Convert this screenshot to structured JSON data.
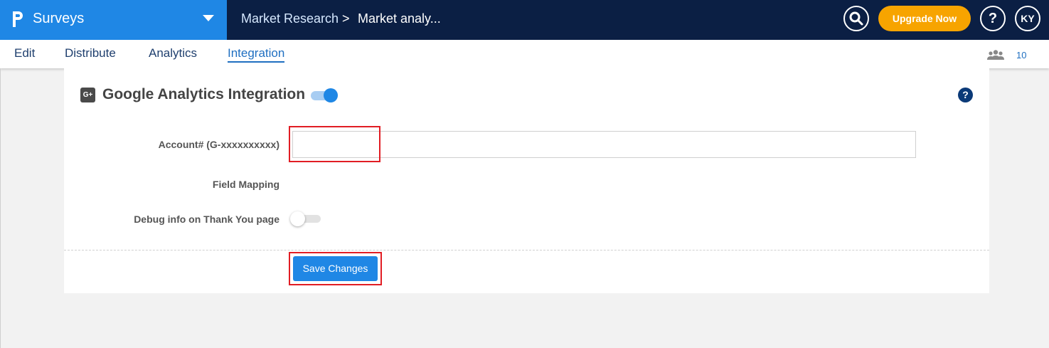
{
  "app": {
    "name": "Surveys"
  },
  "breadcrumb": {
    "item1": "Market Research",
    "separator": ">",
    "item2": "Market analy..."
  },
  "header": {
    "upgrade_label": "Upgrade Now",
    "help_label": "?",
    "avatar_initials": "KY"
  },
  "tabs": [
    {
      "label": "Edit"
    },
    {
      "label": "Distribute"
    },
    {
      "label": "Analytics"
    },
    {
      "label": "Integration",
      "active": true
    }
  ],
  "collaborators": {
    "count": "10"
  },
  "panel": {
    "badge": "G+",
    "title": "Google Analytics Integration",
    "enabled": true,
    "help_label": "?"
  },
  "form": {
    "account_label": "Account# (G-xxxxxxxxxx)",
    "account_value": "",
    "mapping_label": "Field Mapping",
    "debug_label": "Debug info on Thank You page",
    "debug_enabled": false,
    "save_label": "Save Changes"
  },
  "colors": {
    "topbar": "#0b1f44",
    "accent": "#1f87e5",
    "upgrade": "#f7a400",
    "highlight": "#e11d24"
  },
  "icons": {
    "logo": "p-logo-icon",
    "caret": "caret-down-icon",
    "search": "search-icon",
    "people": "people-icon"
  }
}
